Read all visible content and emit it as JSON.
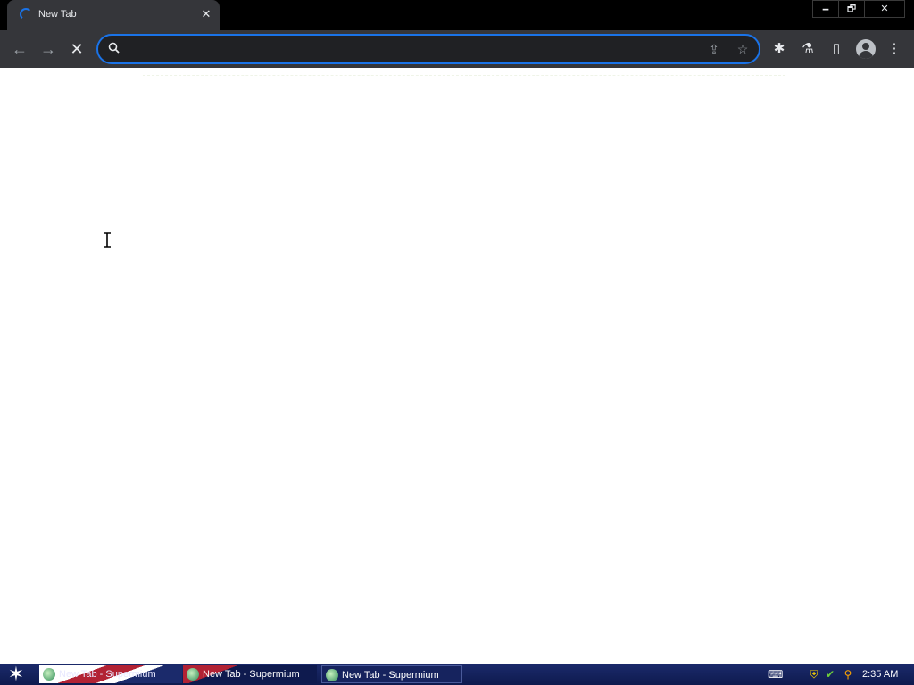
{
  "tab": {
    "title": "New Tab",
    "close_glyph": "✕"
  },
  "window_controls": {
    "minimize": "🗕",
    "restore": "🗗",
    "close": "✕"
  },
  "toolbar": {
    "back_glyph": "←",
    "forward_glyph": "→",
    "stop_glyph": "✕",
    "omnibox": {
      "value": "",
      "placeholder": ""
    },
    "share_glyph": "⇪",
    "star_glyph": "☆",
    "extensions_glyph": "✱",
    "labs_glyph": "⚗",
    "sidepanel_glyph": "▯",
    "menu_glyph": "⋮"
  },
  "taskbar": {
    "start_glyph": "✶",
    "tasks": [
      {
        "label": "New Tab - Supermium"
      },
      {
        "label": "New Tab - Supermium"
      },
      {
        "label": "New Tab - Supermium"
      }
    ],
    "tray": {
      "keyboard_glyph": "⌨",
      "shield_glyph": "⛨",
      "check_glyph": "✔",
      "search_glyph": "⚲"
    },
    "clock": "2:35 AM"
  },
  "colors": {
    "accent": "#1a73e8",
    "toolbar": "#35363a",
    "taskbar": "#1b2a6b"
  }
}
